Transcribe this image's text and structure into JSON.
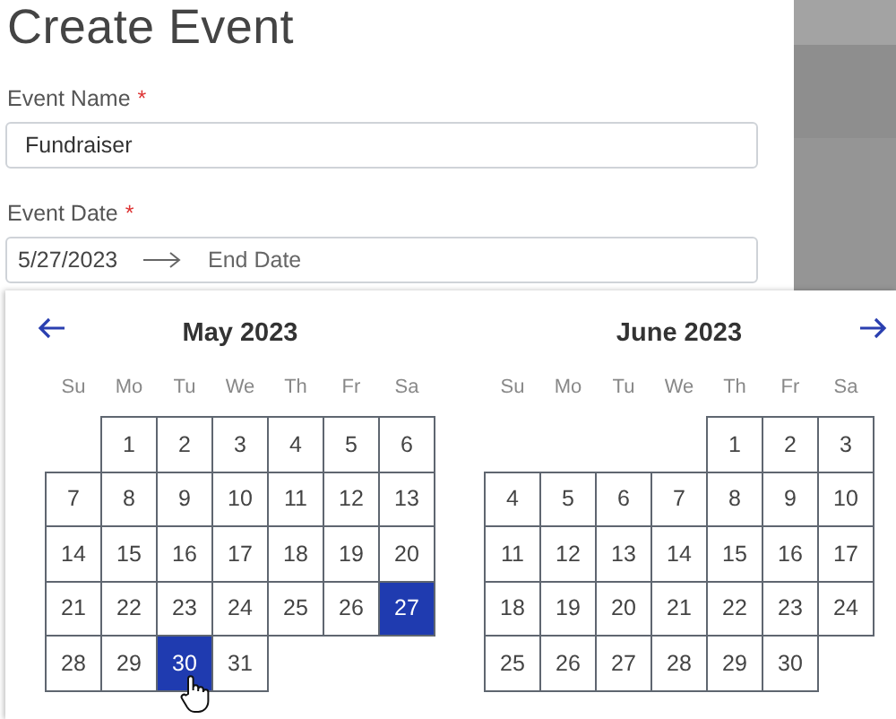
{
  "title": "Create Event",
  "fields": [
    {
      "label": "Event Name",
      "required_mark": "*",
      "kind": "text",
      "value": "Fundraiser"
    },
    {
      "label": "Event Date",
      "required_mark": "*",
      "kind": "range",
      "start": "5/27/2023",
      "end_placeholder": "End Date"
    }
  ],
  "calendar": {
    "months": [
      {
        "title": "May 2023",
        "weekdays": [
          "Su",
          "Mo",
          "Tu",
          "We",
          "Th",
          "Fr",
          "Sa"
        ],
        "weeks": [
          [
            {
              "kind": "blank"
            },
            {
              "kind": "day",
              "day": "1",
              "selected": false
            },
            {
              "kind": "day",
              "day": "2",
              "selected": false
            },
            {
              "kind": "day",
              "day": "3",
              "selected": false
            },
            {
              "kind": "day",
              "day": "4",
              "selected": false
            },
            {
              "kind": "day",
              "day": "5",
              "selected": false
            },
            {
              "kind": "day",
              "day": "6",
              "selected": false
            }
          ],
          [
            {
              "kind": "day",
              "day": "7",
              "selected": false
            },
            {
              "kind": "day",
              "day": "8",
              "selected": false
            },
            {
              "kind": "day",
              "day": "9",
              "selected": false
            },
            {
              "kind": "day",
              "day": "10",
              "selected": false
            },
            {
              "kind": "day",
              "day": "11",
              "selected": false
            },
            {
              "kind": "day",
              "day": "12",
              "selected": false
            },
            {
              "kind": "day",
              "day": "13",
              "selected": false
            }
          ],
          [
            {
              "kind": "day",
              "day": "14",
              "selected": false
            },
            {
              "kind": "day",
              "day": "15",
              "selected": false
            },
            {
              "kind": "day",
              "day": "16",
              "selected": false
            },
            {
              "kind": "day",
              "day": "17",
              "selected": false
            },
            {
              "kind": "day",
              "day": "18",
              "selected": false
            },
            {
              "kind": "day",
              "day": "19",
              "selected": false
            },
            {
              "kind": "day",
              "day": "20",
              "selected": false
            }
          ],
          [
            {
              "kind": "day",
              "day": "21",
              "selected": false
            },
            {
              "kind": "day",
              "day": "22",
              "selected": false
            },
            {
              "kind": "day",
              "day": "23",
              "selected": false
            },
            {
              "kind": "day",
              "day": "24",
              "selected": false
            },
            {
              "kind": "day",
              "day": "25",
              "selected": false
            },
            {
              "kind": "day",
              "day": "26",
              "selected": false
            },
            {
              "kind": "day",
              "day": "27",
              "selected": true
            }
          ],
          [
            {
              "kind": "day",
              "day": "28",
              "selected": false
            },
            {
              "kind": "day",
              "day": "29",
              "selected": false
            },
            {
              "kind": "day",
              "day": "30",
              "selected": true
            },
            {
              "kind": "day",
              "day": "31",
              "selected": false
            },
            {
              "kind": "blank"
            },
            {
              "kind": "blank"
            },
            {
              "kind": "blank"
            }
          ]
        ]
      },
      {
        "title": "June 2023",
        "weekdays": [
          "Su",
          "Mo",
          "Tu",
          "We",
          "Th",
          "Fr",
          "Sa"
        ],
        "weeks": [
          [
            {
              "kind": "blank"
            },
            {
              "kind": "blank"
            },
            {
              "kind": "blank"
            },
            {
              "kind": "blank"
            },
            {
              "kind": "day",
              "day": "1",
              "selected": false
            },
            {
              "kind": "day",
              "day": "2",
              "selected": false
            },
            {
              "kind": "day",
              "day": "3",
              "selected": false
            }
          ],
          [
            {
              "kind": "day",
              "day": "4",
              "selected": false
            },
            {
              "kind": "day",
              "day": "5",
              "selected": false
            },
            {
              "kind": "day",
              "day": "6",
              "selected": false
            },
            {
              "kind": "day",
              "day": "7",
              "selected": false
            },
            {
              "kind": "day",
              "day": "8",
              "selected": false
            },
            {
              "kind": "day",
              "day": "9",
              "selected": false
            },
            {
              "kind": "day",
              "day": "10",
              "selected": false
            }
          ],
          [
            {
              "kind": "day",
              "day": "11",
              "selected": false
            },
            {
              "kind": "day",
              "day": "12",
              "selected": false
            },
            {
              "kind": "day",
              "day": "13",
              "selected": false
            },
            {
              "kind": "day",
              "day": "14",
              "selected": false
            },
            {
              "kind": "day",
              "day": "15",
              "selected": false
            },
            {
              "kind": "day",
              "day": "16",
              "selected": false
            },
            {
              "kind": "day",
              "day": "17",
              "selected": false
            }
          ],
          [
            {
              "kind": "day",
              "day": "18",
              "selected": false
            },
            {
              "kind": "day",
              "day": "19",
              "selected": false
            },
            {
              "kind": "day",
              "day": "20",
              "selected": false
            },
            {
              "kind": "day",
              "day": "21",
              "selected": false
            },
            {
              "kind": "day",
              "day": "22",
              "selected": false
            },
            {
              "kind": "day",
              "day": "23",
              "selected": false
            },
            {
              "kind": "day",
              "day": "24",
              "selected": false
            }
          ],
          [
            {
              "kind": "day",
              "day": "25",
              "selected": false
            },
            {
              "kind": "day",
              "day": "26",
              "selected": false
            },
            {
              "kind": "day",
              "day": "27",
              "selected": false
            },
            {
              "kind": "day",
              "day": "28",
              "selected": false
            },
            {
              "kind": "day",
              "day": "29",
              "selected": false
            },
            {
              "kind": "day",
              "day": "30",
              "selected": false
            },
            {
              "kind": "blank"
            }
          ]
        ]
      }
    ]
  }
}
